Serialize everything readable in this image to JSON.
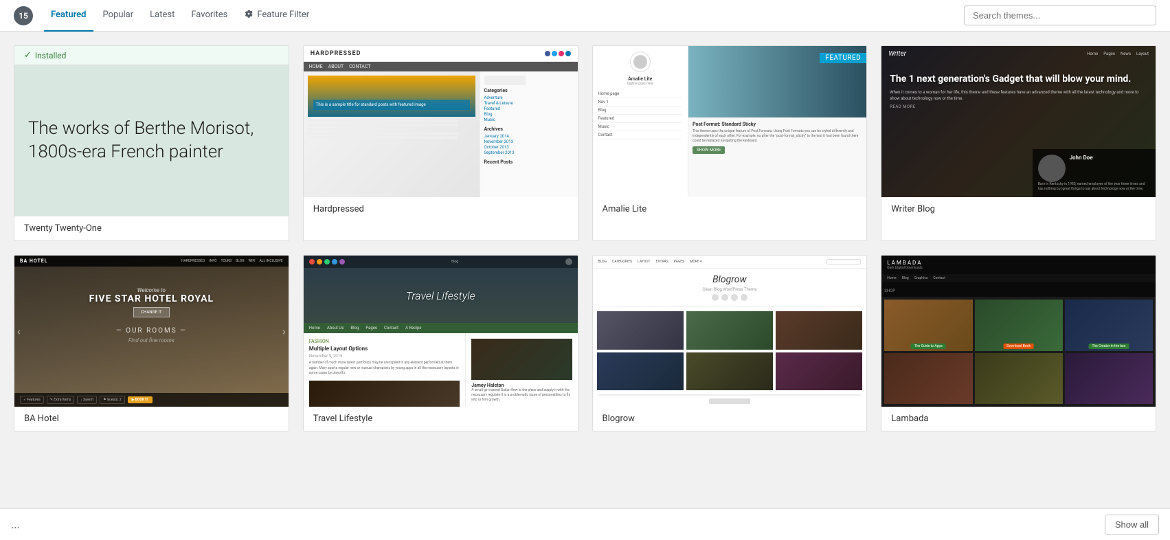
{
  "nav": {
    "theme_count": "15",
    "tabs": [
      {
        "id": "featured",
        "label": "Featured",
        "active": true
      },
      {
        "id": "popular",
        "label": "Popular",
        "active": false
      },
      {
        "id": "latest",
        "label": "Latest",
        "active": false
      },
      {
        "id": "favorites",
        "label": "Favorites",
        "active": false
      },
      {
        "id": "feature-filter",
        "label": "Feature Filter",
        "active": false,
        "has_icon": true
      }
    ],
    "search_placeholder": "Search themes..."
  },
  "themes": [
    {
      "id": "twenty-twenty-one",
      "name": "Twenty Twenty-One",
      "installed": true,
      "featured": false,
      "type": "twentyone"
    },
    {
      "id": "hardpressed",
      "name": "Hardpressed",
      "installed": false,
      "featured": false,
      "type": "hardpressed"
    },
    {
      "id": "amalie-lite",
      "name": "Amalie Lite",
      "installed": false,
      "featured": true,
      "type": "amalie"
    },
    {
      "id": "writer-blog",
      "name": "Writer Blog",
      "installed": false,
      "featured": false,
      "type": "writer"
    },
    {
      "id": "ba-hotel",
      "name": "BA Hotel",
      "installed": false,
      "featured": false,
      "type": "bahotel"
    },
    {
      "id": "travel-lifestyle",
      "name": "Travel Lifestyle",
      "installed": false,
      "featured": false,
      "type": "travel"
    },
    {
      "id": "blogrow",
      "name": "Blogrow",
      "installed": false,
      "featured": false,
      "type": "blogrow"
    },
    {
      "id": "lambada",
      "name": "Lambada",
      "installed": false,
      "featured": false,
      "type": "lambada"
    }
  ],
  "installed_label": "Installed",
  "featured_label": "FEATURED",
  "bottom": {
    "dots": "...",
    "show_all": "Show all"
  }
}
